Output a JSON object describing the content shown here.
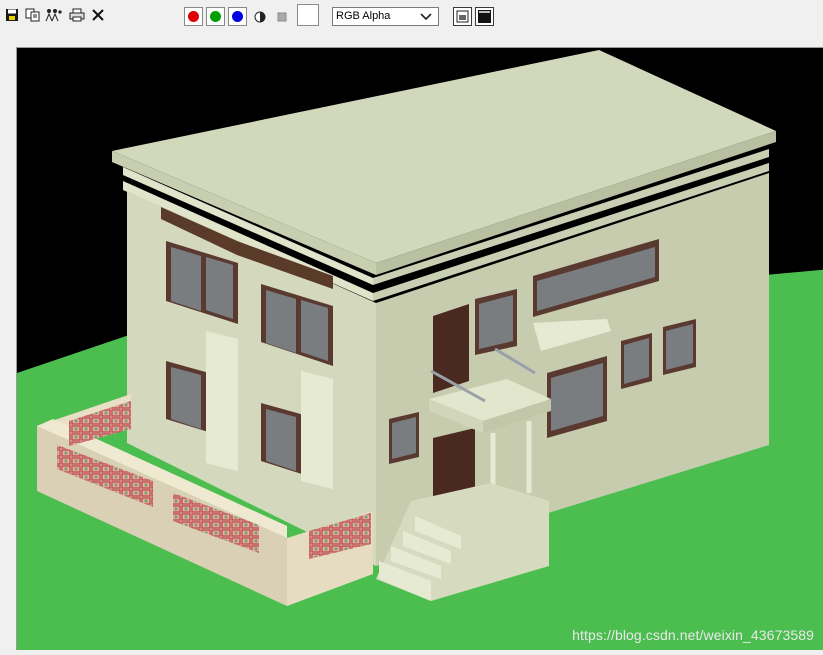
{
  "toolbar": {
    "icons": [
      {
        "name": "save-image-icon"
      },
      {
        "name": "copy-image-icon"
      },
      {
        "name": "clone-window-icon"
      },
      {
        "name": "print-icon"
      },
      {
        "name": "clear-icon"
      }
    ],
    "channels": [
      {
        "name": "red-channel",
        "color": "#e00000"
      },
      {
        "name": "green-channel",
        "color": "#00a000"
      },
      {
        "name": "blue-channel",
        "color": "#0000e0"
      }
    ],
    "monochrome_icon": "monochrome-icon",
    "clear_channel_icon": "clear-channel-icon",
    "swatch_color": "#ffffff",
    "channel_display": "RGB Alpha"
  },
  "render": {
    "background_color": "#000000",
    "ground_color": "#4cbe50",
    "watermark": "https://blog.csdn.net/weixin_43673589"
  }
}
